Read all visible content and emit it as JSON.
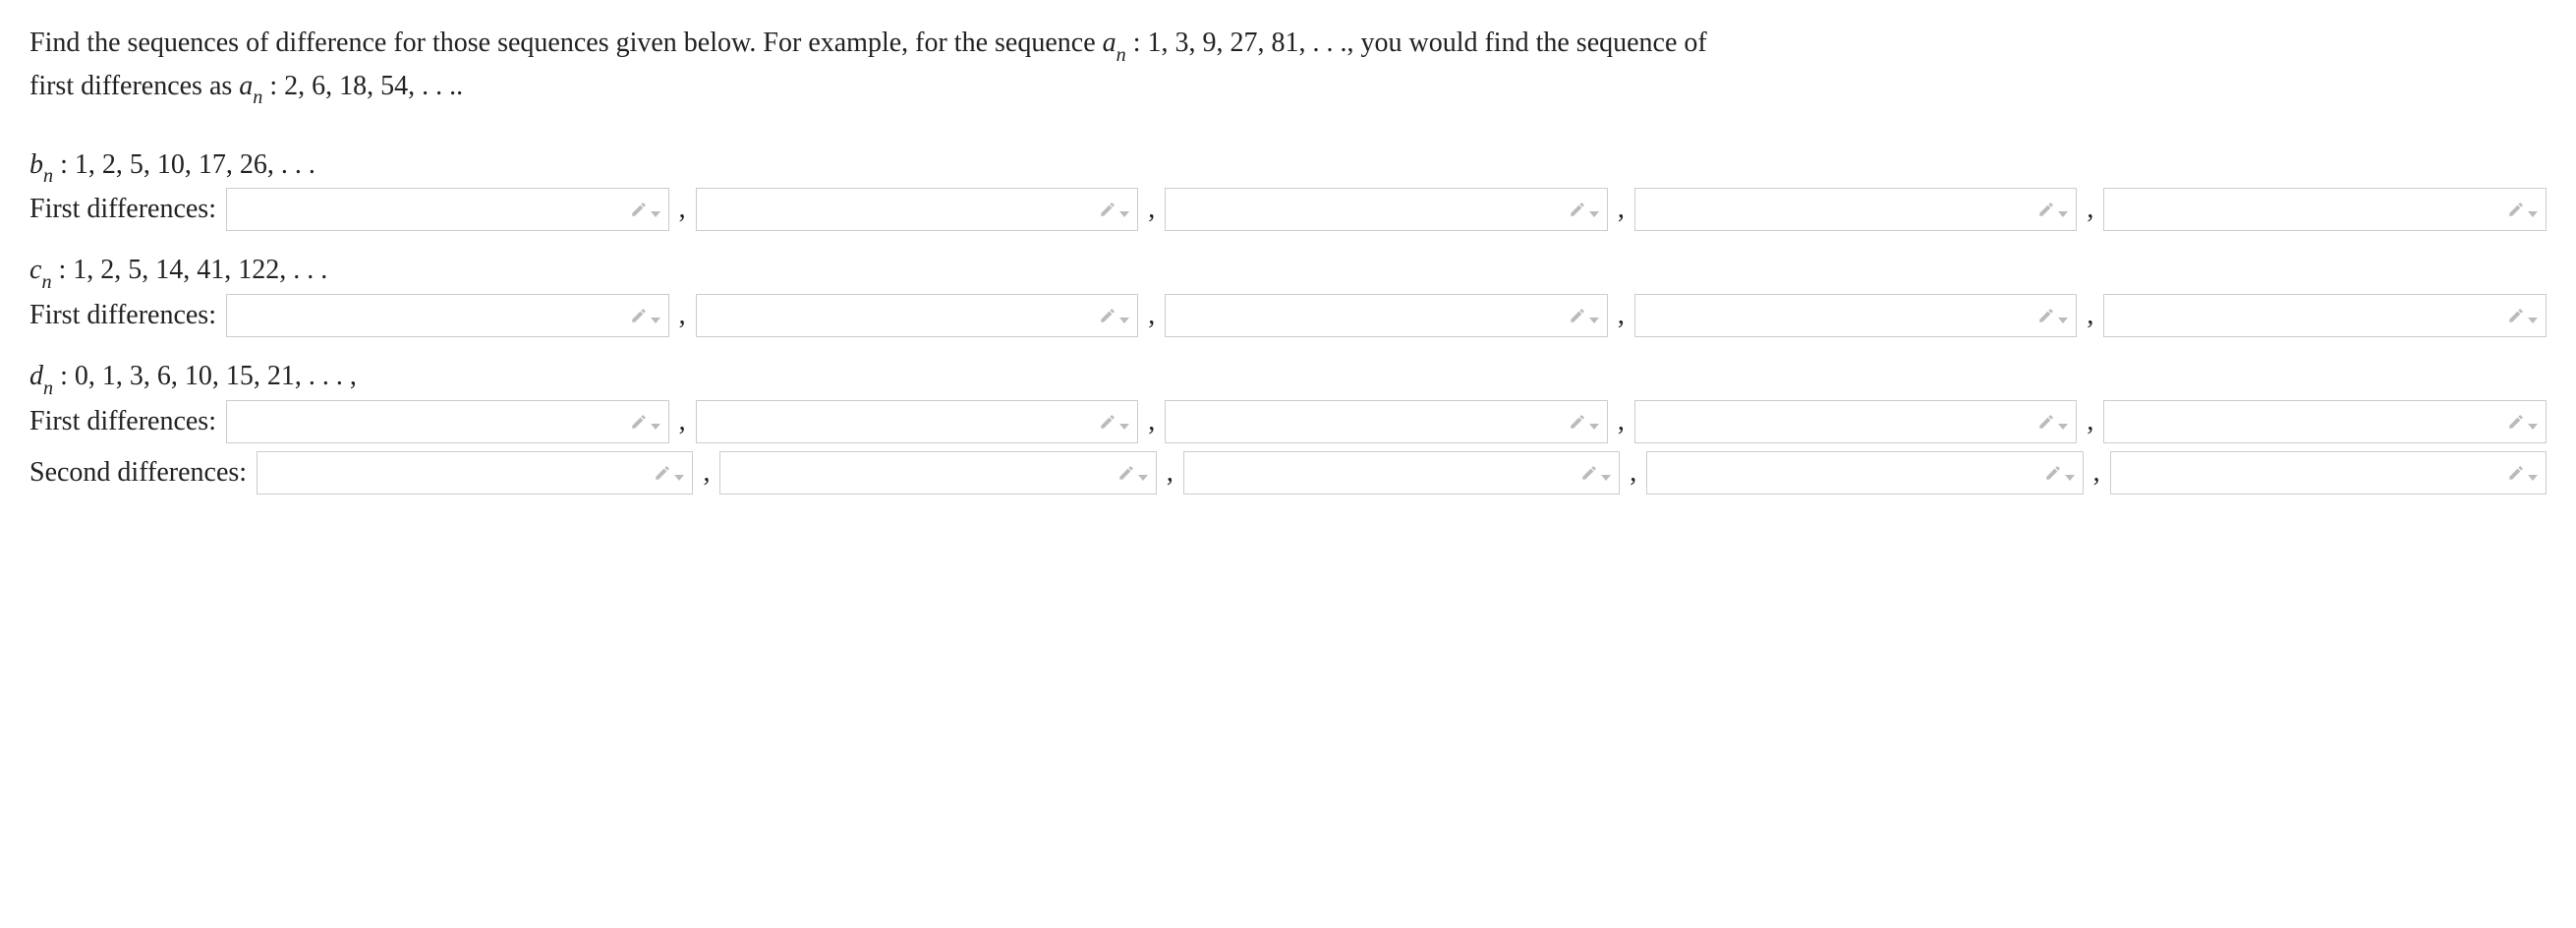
{
  "intro": {
    "line1_pre": "Find the sequences of difference for those sequences given below. For example, for the sequence ",
    "an_var": "a",
    "an_sub": "n",
    "an_seq": " : 1, 3, 9, 27, 81, . . .",
    "line1_post": ", you would find the sequence of",
    "line2_pre": "first differences as ",
    "line2_seq": " : 2, 6, 18, 54, . . ..",
    "line2_var": "a",
    "line2_sub": "n"
  },
  "problems": [
    {
      "var": "b",
      "sub": "n",
      "seq": " : 1, 2, 5, 10, 17, 26, . . .",
      "rows": [
        {
          "label": "First differences:",
          "inputs": 5
        }
      ]
    },
    {
      "var": "c",
      "sub": "n",
      "seq": " : 1, 2, 5, 14, 41, 122, . . .",
      "rows": [
        {
          "label": "First differences:",
          "inputs": 5
        }
      ]
    },
    {
      "var": "d",
      "sub": "n",
      "seq": " : 0, 1, 3, 6, 10, 15, 21, . . . ,",
      "rows": [
        {
          "label": "First differences:",
          "inputs": 5
        },
        {
          "label": "Second differences:",
          "inputs": 5
        }
      ]
    }
  ]
}
